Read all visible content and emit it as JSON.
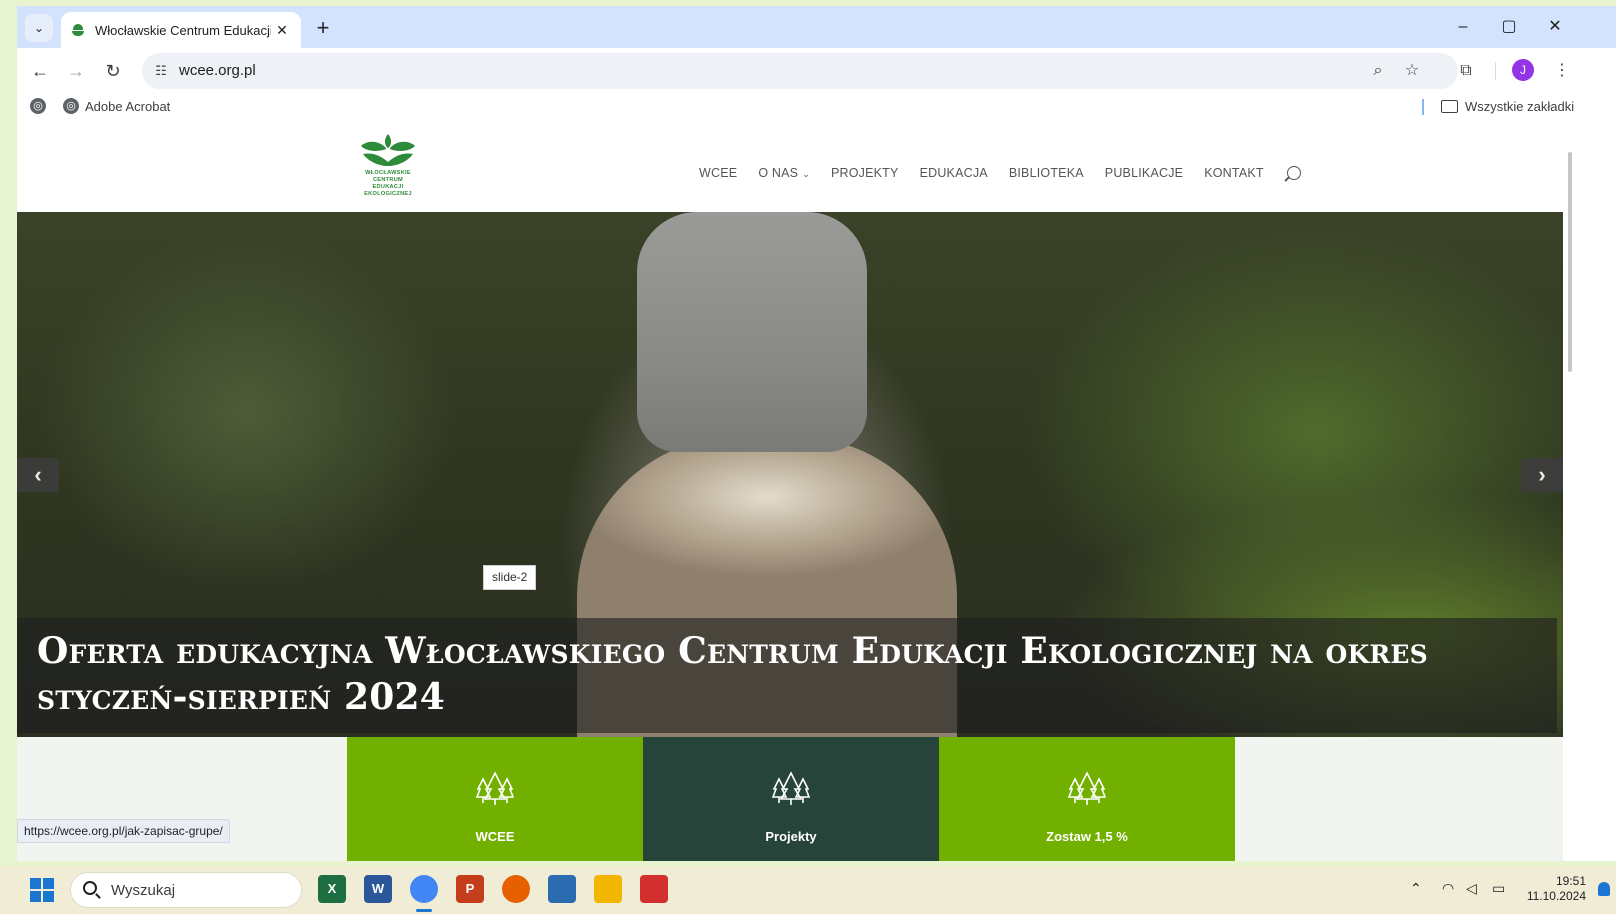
{
  "browser": {
    "tab_title": "Włocławskie Centrum Edukacji",
    "new_tab_label": "+",
    "url": "wcee.org.pl",
    "profile_initial": "J",
    "bookmarks": [
      {
        "label": ""
      },
      {
        "label": "Adobe Acrobat"
      }
    ],
    "all_bookmarks_label": "Wszystkie zakładki",
    "status_url": "https://wcee.org.pl/jak-zapisac-grupe/"
  },
  "site": {
    "logo_text": [
      "WŁOCŁAWSKIE",
      "CENTRUM",
      "EDUKACJI",
      "EKOLOGICZNEJ"
    ],
    "nav": [
      {
        "label": "WCEE"
      },
      {
        "label": "O NAS",
        "has_caret": true
      },
      {
        "label": "PROJEKTY"
      },
      {
        "label": "EDUKACJA"
      },
      {
        "label": "BIBLIOTEKA"
      },
      {
        "label": "PUBLIKACJE"
      },
      {
        "label": "KONTAKT"
      }
    ],
    "slider": {
      "tooltip": "slide-2",
      "caption": "Oferta edukacyjna Włocławskiego Centrum Edukacji Ekologicznej na okres styczeń-sierpień 2024",
      "prev_icon": "chevron-left-icon",
      "next_icon": "chevron-right-icon"
    },
    "tiles": [
      {
        "label": "WCEE",
        "color": "#72b000"
      },
      {
        "label": "Projekty",
        "color": "#27443a"
      },
      {
        "label": "Zostaw 1,5 %",
        "color": "#72b000"
      }
    ],
    "brand_green": "#2e8b3a"
  },
  "taskbar": {
    "search_placeholder": "Wyszukaj",
    "apps": [
      {
        "name": "excel-icon",
        "glyph": "X",
        "color": "#1d6f42"
      },
      {
        "name": "word-icon",
        "glyph": "W",
        "color": "#2b579a"
      },
      {
        "name": "chrome-icon",
        "glyph": "",
        "color": "#4285f4",
        "active": true
      },
      {
        "name": "powerpoint-icon",
        "glyph": "P",
        "color": "#c43e1c"
      },
      {
        "name": "firefox-icon",
        "glyph": "",
        "color": "#e66000"
      },
      {
        "name": "app-icon",
        "glyph": "",
        "color": "#2b6cb0"
      },
      {
        "name": "file-explorer-icon",
        "glyph": "",
        "color": "#f2b600"
      },
      {
        "name": "acrobat-icon",
        "glyph": "",
        "color": "#d32f2f"
      }
    ],
    "time": "19:51",
    "date": "11.10.2024"
  }
}
